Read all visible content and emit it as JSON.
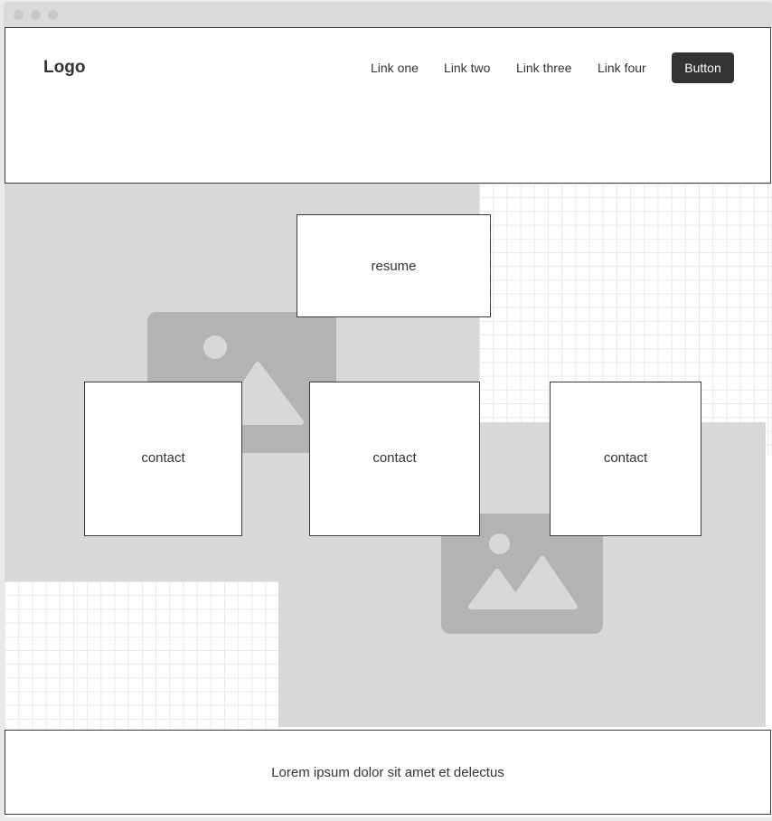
{
  "header": {
    "logo": "Logo",
    "nav": [
      {
        "label": "Link one"
      },
      {
        "label": "Link two"
      },
      {
        "label": "Link three"
      },
      {
        "label": "Link four"
      }
    ],
    "button_label": "Button"
  },
  "main": {
    "resume_label": "resume",
    "contacts": [
      {
        "label": "contact"
      },
      {
        "label": "contact"
      },
      {
        "label": "contact"
      }
    ]
  },
  "footer": {
    "text": "Lorem ipsum dolor sit amet et delectus"
  },
  "colors": {
    "button_bg": "#333333",
    "placeholder_block": "#d8d8d8",
    "image_placeholder": "#b3b3b3"
  }
}
